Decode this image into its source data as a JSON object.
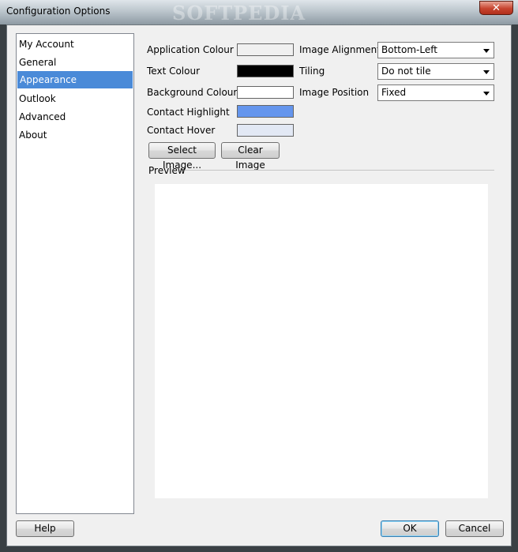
{
  "window": {
    "title": "Configuration Options",
    "watermark": "SOFTPEDIA",
    "close_glyph": "✕"
  },
  "nav": {
    "items": [
      {
        "label": "My Account",
        "selected": false
      },
      {
        "label": "General",
        "selected": false
      },
      {
        "label": "Appearance",
        "selected": true
      },
      {
        "label": "Outlook",
        "selected": false
      },
      {
        "label": "Advanced",
        "selected": false
      },
      {
        "label": "About",
        "selected": false
      }
    ]
  },
  "appearance": {
    "application_colour_label": "Application Colour",
    "text_colour_label": "Text Colour",
    "background_colour_label": "Background Colour",
    "contact_highlight_label": "Contact Highlight",
    "contact_hover_label": "Contact Hover",
    "colors": {
      "application": "#f0f0f0",
      "text": "#000000",
      "background": "#ffffff",
      "contact_highlight": "#6495ed",
      "contact_hover": "#e2e8f4"
    },
    "image_alignment_label": "Image Alignment",
    "image_alignment_value": "Bottom-Left",
    "tiling_label": "Tiling",
    "tiling_value": "Do not tile",
    "image_position_label": "Image Position",
    "image_position_value": "Fixed",
    "select_image_label": "Select Image...",
    "clear_image_label": "Clear Image",
    "preview_label": "Preview"
  },
  "footer": {
    "help_label": "Help",
    "ok_label": "OK",
    "cancel_label": "Cancel"
  },
  "theme": {
    "selection_color": "#4a8ad8"
  }
}
